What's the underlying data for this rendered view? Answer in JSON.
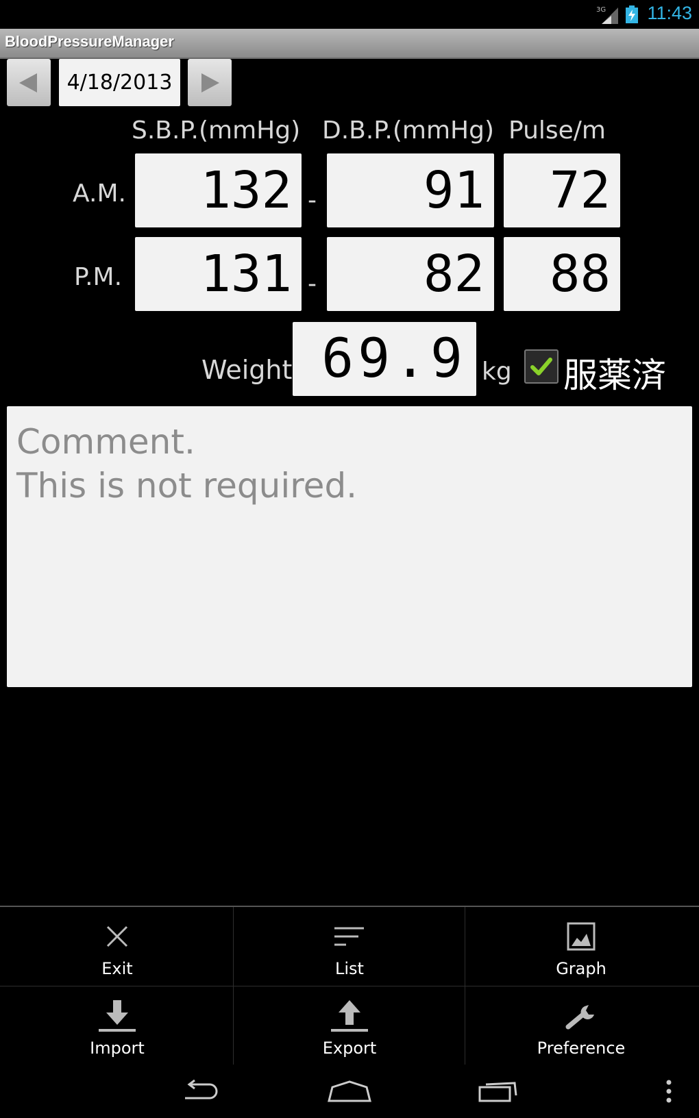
{
  "status_bar": {
    "network": "3G",
    "time": "11:43"
  },
  "app": {
    "title": "BloodPressureManager"
  },
  "date_nav": {
    "date": "4/18/2013"
  },
  "headers": {
    "sbp": "S.B.P.(mmHg)",
    "dbp": "D.B.P.(mmHg)",
    "pulse": "Pulse/m"
  },
  "rows": [
    {
      "label": "A.M.",
      "sbp": "132",
      "separator": "-",
      "dbp": "91",
      "pulse": "72"
    },
    {
      "label": "P.M.",
      "sbp": "131",
      "separator": "-",
      "dbp": "82",
      "pulse": "88"
    }
  ],
  "weight": {
    "label": "Weight",
    "value": "69.9",
    "unit": "kg"
  },
  "medication": {
    "label": "服薬済",
    "checked": true
  },
  "comment": {
    "placeholder": "Comment.\nThis is not required."
  },
  "menu": {
    "items": [
      {
        "label": "Exit",
        "icon": "close-icon"
      },
      {
        "label": "List",
        "icon": "list-icon"
      },
      {
        "label": "Graph",
        "icon": "image-icon"
      },
      {
        "label": "Import",
        "icon": "download-icon"
      },
      {
        "label": "Export",
        "icon": "upload-icon"
      },
      {
        "label": "Preference",
        "icon": "wrench-icon"
      }
    ]
  },
  "system_nav": {
    "buttons": [
      "back-icon",
      "home-icon",
      "recent-apps-icon",
      "overflow-menu-icon"
    ]
  },
  "colors": {
    "clock": "#33b5e5",
    "checkmark": "#8ad22a",
    "input_bg": "#f2f2f2"
  }
}
